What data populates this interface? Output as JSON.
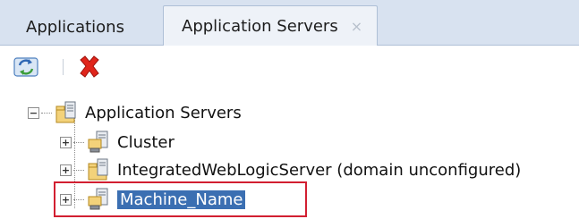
{
  "tabs": [
    {
      "label": "Applications"
    },
    {
      "label": "Application Servers",
      "close": "×"
    }
  ],
  "toolbar": {
    "refresh_icon": "refresh-icon",
    "delete_icon": "delete-icon"
  },
  "tree": {
    "root": {
      "label": "Application Servers",
      "toggle": "−"
    },
    "children": [
      {
        "label": "Cluster",
        "toggle": "+"
      },
      {
        "label": "IntegratedWebLogicServer (domain unconfigured)",
        "toggle": "+"
      },
      {
        "label": "Machine_Name",
        "toggle": "+",
        "selected": true
      }
    ]
  },
  "colors": {
    "selection": "#3b6fb2",
    "highlight_border": "#d21f31",
    "delete": "#e0251b"
  }
}
